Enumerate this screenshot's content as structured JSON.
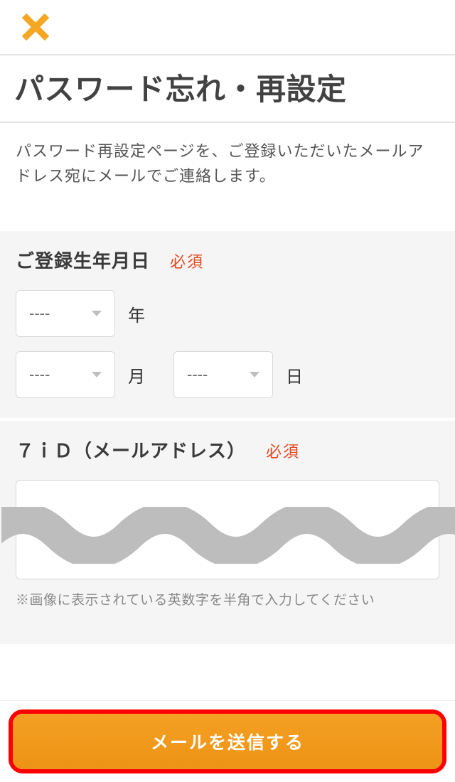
{
  "header": {
    "close_icon_name": "close-icon"
  },
  "title": "パスワード忘れ・再設定",
  "description": "パスワード再設定ページを、ご登録いただいたメールアドレス宛にメールでご連絡します。",
  "required_tag": "必須",
  "birthdate": {
    "label": "ご登録生年月日",
    "year_placeholder": "----",
    "year_unit": "年",
    "month_placeholder": "----",
    "month_unit": "月",
    "day_placeholder": "----",
    "day_unit": "日"
  },
  "email": {
    "label": "７ｉＤ（メールアドレス）",
    "value": ""
  },
  "captcha_hint": "※画像に表示されている英数字を半角で入力してください",
  "footer": {
    "send_button_label": "メールを送信する"
  },
  "colors": {
    "accent_orange": "#f59e0b",
    "required_red": "#e24a21",
    "highlight_red": "#ff0000"
  }
}
